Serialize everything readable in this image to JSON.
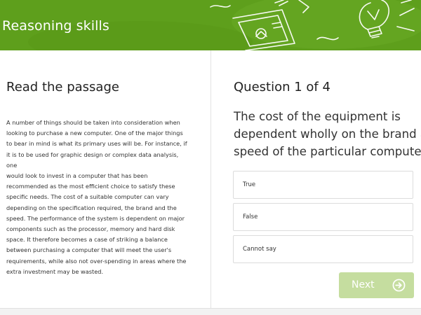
{
  "header": {
    "title": "Reasoning skills",
    "background_color": "#5e9f1c"
  },
  "passage_panel": {
    "heading": "Read the passage",
    "lines": [
      "A number of things should be taken into consideration when",
      "looking to purchase a new computer. One of the major things",
      "to bear in mind is what its primary uses will be. For instance, if",
      "it is to be used for graphic design or complex data analysis, one",
      "would look to invest in a computer that has been",
      "recommended as the most efficient choice to satisfy these",
      "specific needs. The cost of a suitable computer can vary",
      "depending on the specification required, the brand and the",
      "speed. The performance of the system is dependent on major",
      "components such as the processor, memory and hard disk",
      "space. It therefore becomes a case of striking a balance",
      "between purchasing a computer that will meet the user's",
      "requirements, while also not over-spending in areas where the",
      "extra investment may be wasted."
    ]
  },
  "question_panel": {
    "heading": "Question 1 of 4",
    "question_lines": [
      "The cost of the equipment is",
      "dependent wholly on the brand and",
      "speed of the particular computer."
    ],
    "options": [
      {
        "label": "True"
      },
      {
        "label": "False"
      },
      {
        "label": "Cannot say"
      }
    ],
    "next_button": {
      "label": "Next",
      "icon": "arrow-right-circle-icon",
      "color": "#c5dd9f"
    }
  }
}
